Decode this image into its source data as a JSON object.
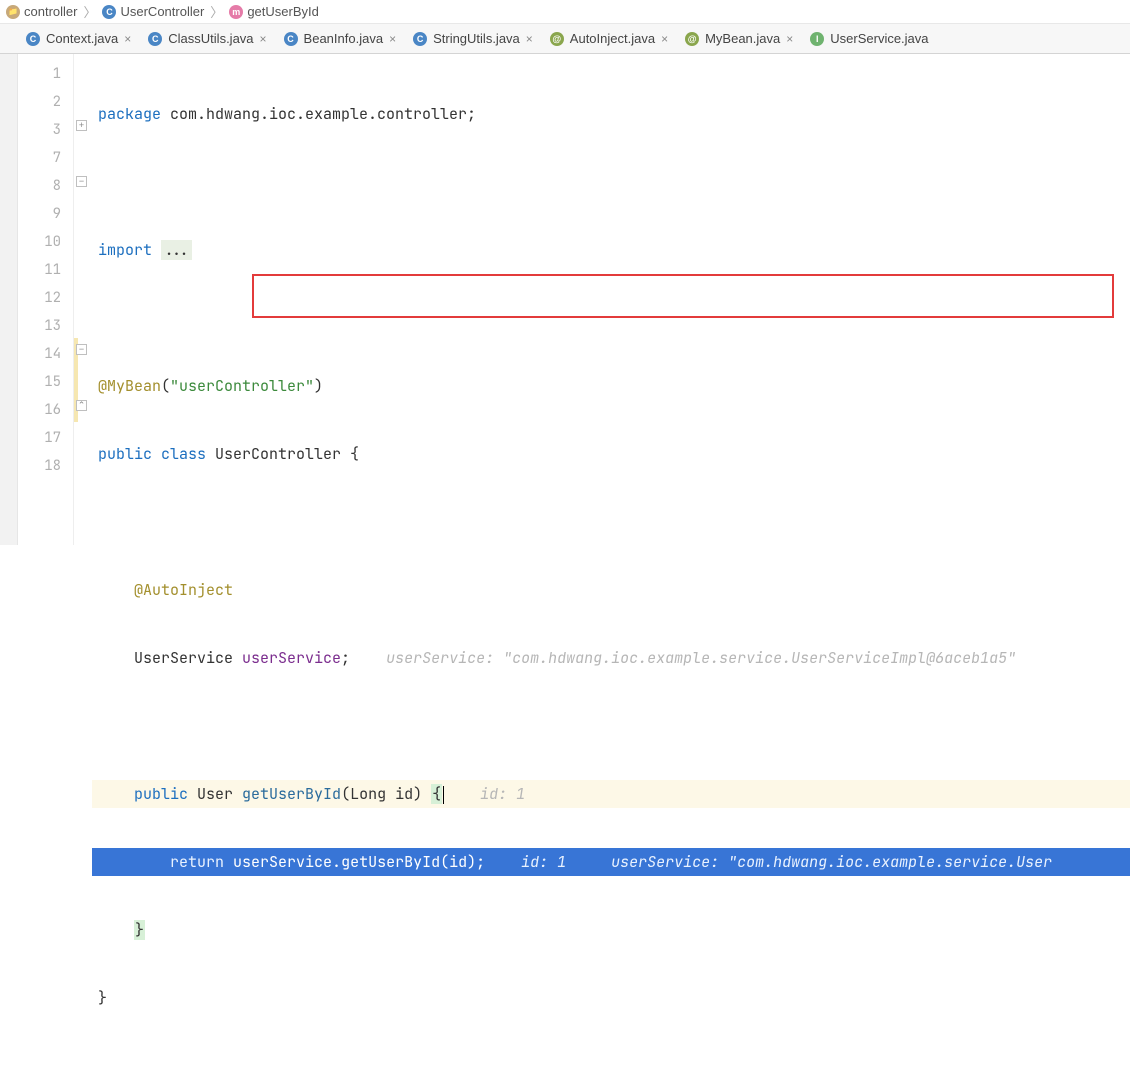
{
  "breadcrumbs": {
    "items": [
      {
        "icon": "folder",
        "label": "controller"
      },
      {
        "icon": "class",
        "label": "UserController"
      },
      {
        "icon": "method",
        "label": "getUserById"
      }
    ]
  },
  "tabs": [
    {
      "icon": "class",
      "label": "Context.java"
    },
    {
      "icon": "class",
      "label": "ClassUtils.java"
    },
    {
      "icon": "class",
      "label": "BeanInfo.java"
    },
    {
      "icon": "class",
      "label": "StringUtils.java"
    },
    {
      "icon": "anno",
      "label": "AutoInject.java"
    },
    {
      "icon": "anno",
      "label": "MyBean.java"
    },
    {
      "icon": "iface",
      "label": "UserService.java"
    }
  ],
  "gutter": {
    "lines": [
      "1",
      "2",
      "3",
      "7",
      "8",
      "9",
      "10",
      "11",
      "12",
      "13",
      "14",
      "15",
      "16",
      "17",
      "18"
    ],
    "breakpoint_line_index": 11
  },
  "code": {
    "pkg_kw": "package",
    "pkg_name": " com.hdwang.ioc.example.controller;",
    "import_kw": "import ",
    "import_dots": "...",
    "ann_mybean": "@MyBean",
    "ann_mybean_arg": "\"userController\"",
    "cls_public": "public ",
    "cls_class": "class ",
    "cls_name": "UserController {",
    "ann_autoinject": "@AutoInject",
    "field_type": "UserService ",
    "field_name": "userService",
    "field_semi": ";",
    "field_hint": "userService: \"com.hdwang.ioc.example.service.UserServiceImpl@6aceb1a5\"",
    "m_public": "public ",
    "m_rettype": "User ",
    "m_name": "getUserById",
    "m_params": "(Long id) ",
    "m_brace": "{",
    "m_hint_id": "id: 1",
    "ret_kw": "return ",
    "ret_expr_obj": "userService",
    "ret_expr_dot": ".",
    "ret_expr_call": "getUserById(id);",
    "ret_hint_id": "id: 1",
    "ret_hint_svc": "userService: \"com.hdwang.ioc.example.service.User",
    "m_close": "}",
    "cls_close": "}"
  },
  "iconLetters": {
    "folder": "",
    "class": "C",
    "method": "m",
    "iface": "I",
    "anno": "@"
  }
}
